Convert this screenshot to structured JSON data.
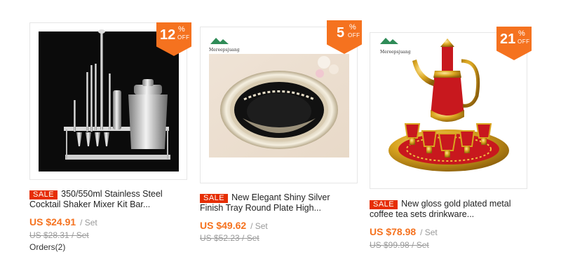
{
  "colors": {
    "accent": "#f5721f",
    "sale": "#e62e04",
    "muted": "#999999"
  },
  "products": [
    {
      "discount": "12",
      "percent": "%",
      "off": "OFF",
      "sale_label": "SALE",
      "title_line1": "350/550ml Stainless Steel",
      "title_line2": "Cocktail Shaker Mixer Kit Bar...",
      "price": "US $24.91",
      "unit": "/ Set",
      "old_price": "US $28.31 / Set",
      "orders": "Orders(2)",
      "image_icon": "cocktail-shaker-set-image"
    },
    {
      "discount": "5",
      "percent": "%",
      "off": "OFF",
      "sale_label": "SALE",
      "title_line1": "New Elegant Shiny Silver",
      "title_line2": "Finish Tray Round Plate High...",
      "price": "US $49.62",
      "unit": "/ Set",
      "old_price": "US $52.23 / Set",
      "logo_text": "Mereepsjuang",
      "image_icon": "silver-tray-image"
    },
    {
      "discount": "21",
      "percent": "%",
      "off": "OFF",
      "sale_label": "SALE",
      "title_line1": "New gloss gold plated metal",
      "title_line2": "coffee tea sets drinkware...",
      "price": "US $78.98",
      "unit": "/ Set",
      "old_price": "US $99.98 / Set",
      "logo_text": "Mereepsjuang",
      "image_icon": "gold-coffee-set-image"
    }
  ]
}
